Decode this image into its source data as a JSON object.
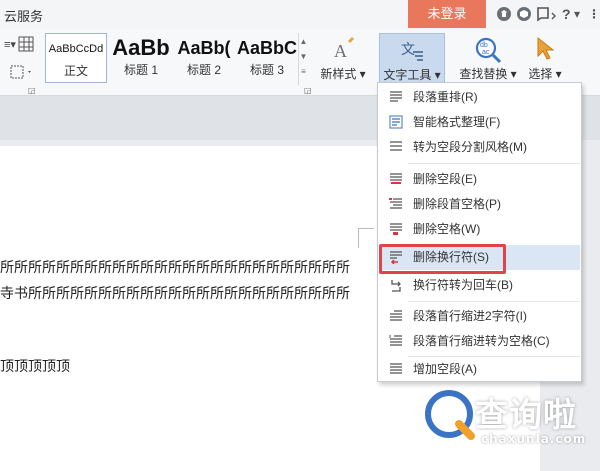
{
  "titlebar": {
    "cloud_label": "云服务",
    "login_label": "未登录",
    "icons": [
      "shirt-icon",
      "cube-icon",
      "feedback-icon",
      "help-icon",
      "more-icon"
    ]
  },
  "ribbon": {
    "styles": [
      {
        "sample": "AaBbCcDd",
        "name": "正文"
      },
      {
        "sample": "AaBb",
        "name": "标题 1"
      },
      {
        "sample": "AaBb(",
        "name": "标题 2"
      },
      {
        "sample": "AaBbC",
        "name": "标题 3"
      }
    ],
    "new_style_label": "新样式",
    "text_tool_label": "文字工具",
    "find_replace_label": "查找替换",
    "select_label": "选择"
  },
  "document": {
    "line1": "所所所所所所所所所所所所所所所所所所所所所所所所所",
    "line2": "寺书所所所所所所所所所所所所所所所所所所所所所所所",
    "line3": "顶顶顶顶顶"
  },
  "menu": {
    "items": [
      {
        "label": "段落重排(R)"
      },
      {
        "label": "智能格式整理(F)"
      },
      {
        "label": "转为空段分割风格(M)"
      },
      {
        "label": "删除空段(E)"
      },
      {
        "label": "删除段首空格(P)"
      },
      {
        "label": "删除空格(W)"
      },
      {
        "label": "删除换行符(S)"
      },
      {
        "label": "换行符转为回车(B)"
      },
      {
        "label": "段落首行缩进2字符(I)"
      },
      {
        "label": "段落首行缩进转为空格(C)"
      },
      {
        "label": "增加空段(A)"
      }
    ]
  },
  "watermark": {
    "name": "查询啦",
    "domain": "chaxunla.com"
  },
  "colors": {
    "login_bg": "#e9775b",
    "selected_tool_bg": "#c9d9ee",
    "highlight_red": "#e0434a",
    "menu_hover": "#dbe6f5"
  }
}
